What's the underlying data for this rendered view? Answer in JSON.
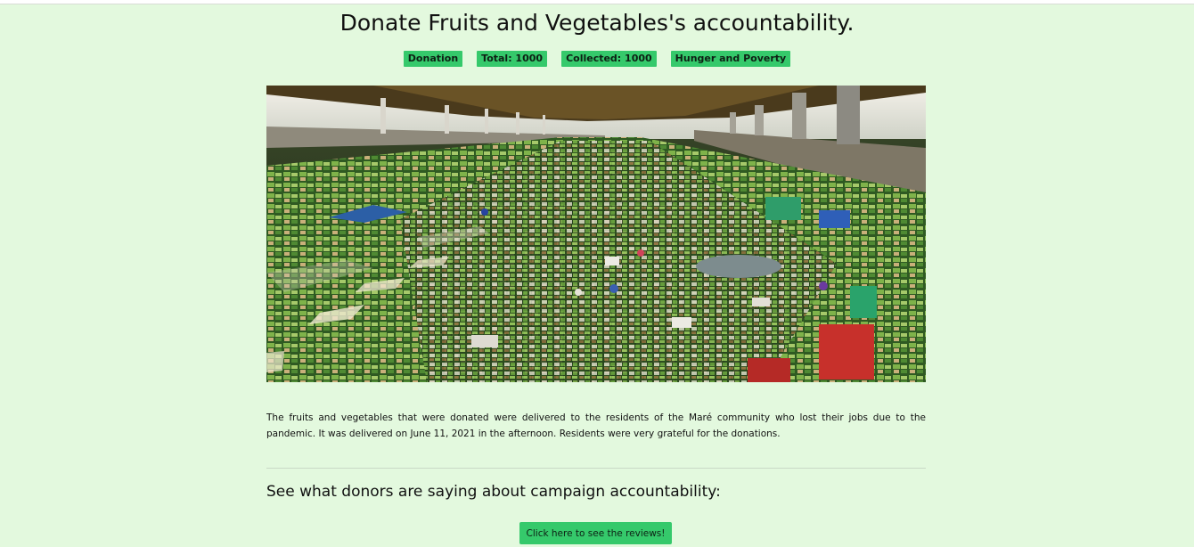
{
  "campaign": {
    "title": "Donate Fruits and Vegetables's accountability.",
    "badges": {
      "type": "Donation",
      "total": "Total: 1000",
      "collected": "Collected: 1000",
      "category": "Hunger and Poverty"
    },
    "photo": {
      "alt": "Crowded produce market under an elevated highway"
    },
    "description": "The fruits and vegetables that were donated were delivered to the residents of the Maré community who lost their jobs due to the pandemic. It was delivered on June 11, 2021 in the afternoon. Residents were very grateful for the donations."
  },
  "reviews": {
    "heading": "See what donors are saying about campaign accountability:",
    "button_label": "Click here to see the reviews!"
  },
  "colors": {
    "background": "#e3f9de",
    "accent": "#35c96b"
  }
}
